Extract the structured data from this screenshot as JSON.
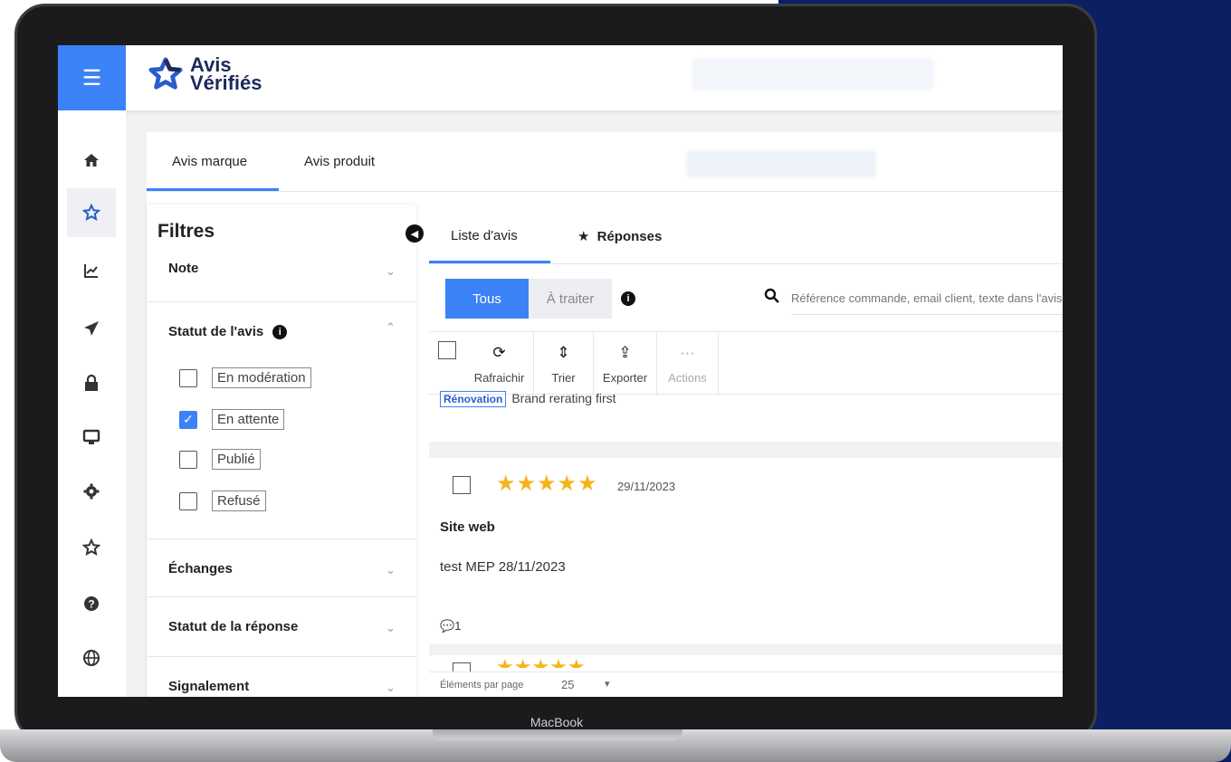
{
  "device_label": "MacBook",
  "topbar": {
    "menu_icon": "hamburger-icon",
    "logo_line1": "Avis",
    "logo_line2": "Vérifiés"
  },
  "leftnav": {
    "items": [
      {
        "icon": "home-icon",
        "active": false
      },
      {
        "icon": "star-icon",
        "active": true
      },
      {
        "icon": "chart-icon",
        "active": false
      },
      {
        "icon": "send-icon",
        "active": false
      },
      {
        "icon": "lock-icon",
        "active": false
      },
      {
        "icon": "monitor-icon",
        "active": false
      },
      {
        "icon": "gear-icon",
        "active": false
      },
      {
        "icon": "star-outline-icon",
        "active": false
      },
      {
        "icon": "help-icon",
        "active": false
      },
      {
        "icon": "globe-icon",
        "active": false
      }
    ]
  },
  "main_tabs": {
    "brand": "Avis marque",
    "product": "Avis produit"
  },
  "filters": {
    "title": "Filtres",
    "note": "Note",
    "statut_avis": "Statut de l'avis",
    "options": [
      {
        "label": "En modération",
        "checked": false
      },
      {
        "label": "En attente",
        "checked": true
      },
      {
        "label": "Publié",
        "checked": false
      },
      {
        "label": "Refusé",
        "checked": false
      }
    ],
    "echanges": "Échanges",
    "statut_reponse": "Statut de la réponse",
    "signalement": "Signalement"
  },
  "reviews": {
    "tab_list": "Liste d'avis",
    "tab_responses": "Réponses",
    "btn_all": "Tous",
    "btn_todo": "À traiter",
    "search_placeholder": "Référence commande, email client, texte dans l'avis",
    "toolbar": {
      "refresh": "Rafraichir",
      "sort": "Trier",
      "export": "Exporter",
      "actions": "Actions"
    },
    "peek_tag": "Rénovation",
    "peek_text": "Brand rerating first",
    "card": {
      "rating": 5,
      "date": "29/11/2023",
      "title": "Site web",
      "text": "test MEP 28/11/2023",
      "comments": "1"
    },
    "pager_label": "Éléments par page",
    "pager_value": "25"
  }
}
